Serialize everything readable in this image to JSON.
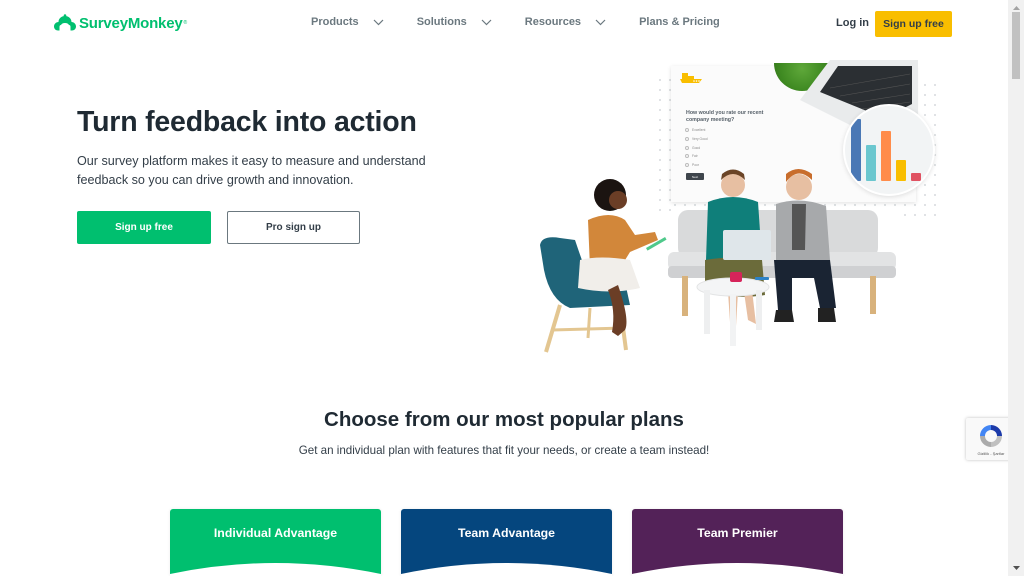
{
  "brand": {
    "name": "SurveyMonkey",
    "registered_mark": "®",
    "logo_icon": "monkey-logo-icon",
    "green": "#00bf6f",
    "yellow": "#f9be00"
  },
  "header": {
    "nav": [
      {
        "label": "Products",
        "icon": "chevron-down-icon"
      },
      {
        "label": "Solutions",
        "icon": "chevron-down-icon"
      },
      {
        "label": "Resources",
        "icon": "chevron-down-icon"
      },
      {
        "label": "Plans & Pricing"
      }
    ],
    "login_label": "Log in",
    "signup_label": "Sign up free"
  },
  "hero": {
    "title": "Turn feedback into action",
    "subtitle": "Our survey platform makes it easy to measure and understand feedback so you can drive growth and innovation.",
    "primary_button": "Sign up free",
    "secondary_button": "Pro sign up",
    "illustration": {
      "survey_question": "How would you rate our recent company meeting?",
      "survey_options": [
        "Excellent",
        "Very Good",
        "Good",
        "Fair",
        "Poor"
      ],
      "survey_next_button": "Next",
      "chart_bars": [
        {
          "value": 100,
          "color": "#4a78b5"
        },
        {
          "value": 58,
          "color": "#6bc7cf"
        },
        {
          "value": 80,
          "color": "#ff8c4a"
        },
        {
          "value": 34,
          "color": "#f9be00"
        },
        {
          "value": 13,
          "color": "#e05262"
        }
      ]
    }
  },
  "plans": {
    "title": "Choose from our most popular plans",
    "subtitle": "Get an individual plan with features that fit your needs, or create a team instead!",
    "cards": [
      {
        "title": "Individual Advantage",
        "color": "#00bf6f"
      },
      {
        "title": "Team Advantage",
        "color": "#05467e"
      },
      {
        "title": "Team Premier",
        "color": "#532258"
      }
    ]
  },
  "recaptcha": {
    "text": "Gizlilik - Şartlar",
    "icon": "recaptcha-icon"
  },
  "scrollbar": {
    "position": 0
  }
}
